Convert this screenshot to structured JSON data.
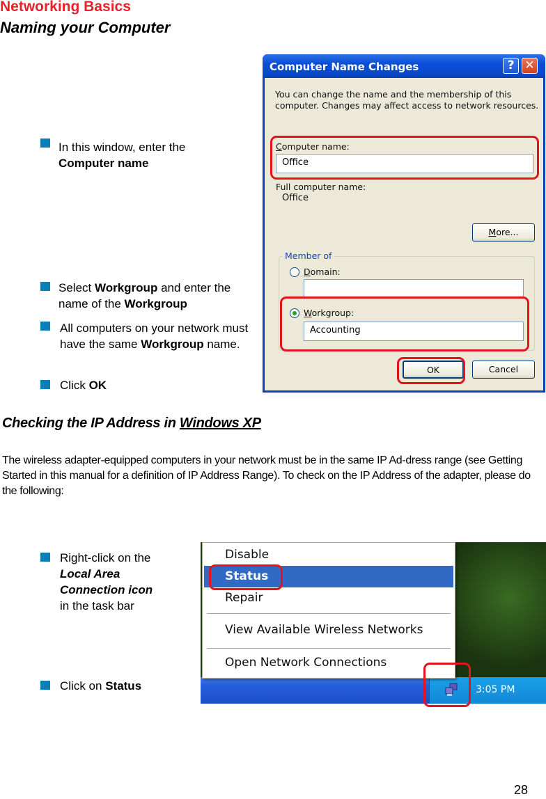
{
  "header": {
    "section": "Networking Basics",
    "title": "Naming your Computer"
  },
  "naming_steps": [
    {
      "parts": [
        {
          "t": "In this window, enter the ",
          "b": false
        },
        {
          "t": "Computer  name",
          "b": true
        }
      ]
    },
    {
      "parts": [
        {
          "t": "Select ",
          "b": false
        },
        {
          "t": "Workgroup",
          "b": true
        },
        {
          "t": " and enter the name of the ",
          "b": false
        },
        {
          "t": "Workgroup",
          "b": true
        }
      ]
    },
    {
      "parts": [
        {
          "t": "All computers on your network must have the same ",
          "b": false
        },
        {
          "t": "Workgroup",
          "b": true
        },
        {
          "t": " name.",
          "b": false
        }
      ]
    },
    {
      "parts": [
        {
          "t": "Click ",
          "b": false
        },
        {
          "t": "OK",
          "b": true
        }
      ]
    }
  ],
  "dialog": {
    "title": "Computer Name Changes",
    "help_label": "?",
    "close_label": "✕",
    "description": "You can change the name and the membership of this computer. Changes may affect access to network resources.",
    "computer_name_label_accel": "C",
    "computer_name_label_rest": "omputer name:",
    "computer_name_value": "Office",
    "full_name_label": "Full computer name:",
    "full_name_value": "Office",
    "more_accel": "M",
    "more_rest": "ore...",
    "member_of_label": "Member of",
    "domain_accel": "D",
    "domain_rest": "omain:",
    "domain_value": "",
    "workgroup_accel": "W",
    "workgroup_rest": "orkgroup:",
    "workgroup_value": "Accounting",
    "selected_membership": "workgroup",
    "ok_label": "OK",
    "cancel_label": "Cancel"
  },
  "ip_section": {
    "title_prefix": "Checking the IP Address in ",
    "title_link": "Windows XP",
    "paragraph": "The wireless adapter-equipped computers in your network must be in the same IP Ad-dress range (see Getting Started in this manual for a definition of IP Address Range).  To check on the IP Address of the adapter, please do the following:"
  },
  "ip_steps": [
    {
      "parts": [
        {
          "t": "Right-click on the",
          "b": false
        },
        {
          "t": "Local Area Connection icon",
          "b": true,
          "i": true
        },
        {
          "t": "in the task bar",
          "b": false
        }
      ]
    },
    {
      "parts": [
        {
          "t": "Click on ",
          "b": false
        },
        {
          "t": "Status",
          "b": true
        }
      ]
    }
  ],
  "context_menu": {
    "items": [
      "Disable",
      "Status",
      "Repair",
      "View Available Wireless Networks",
      "Open Network Connections"
    ],
    "selected": "Status"
  },
  "taskbar": {
    "clock": "3:05 PM",
    "tray_icon": "local-area-connection-icon"
  },
  "colors": {
    "section_red": "#e8222a",
    "bullet_blue": "#0a7fb8",
    "highlight_red": "#e3141e",
    "xp_title_blue": "#0a4ed8",
    "menu_selection": "#316ac5"
  },
  "page_number": "28"
}
